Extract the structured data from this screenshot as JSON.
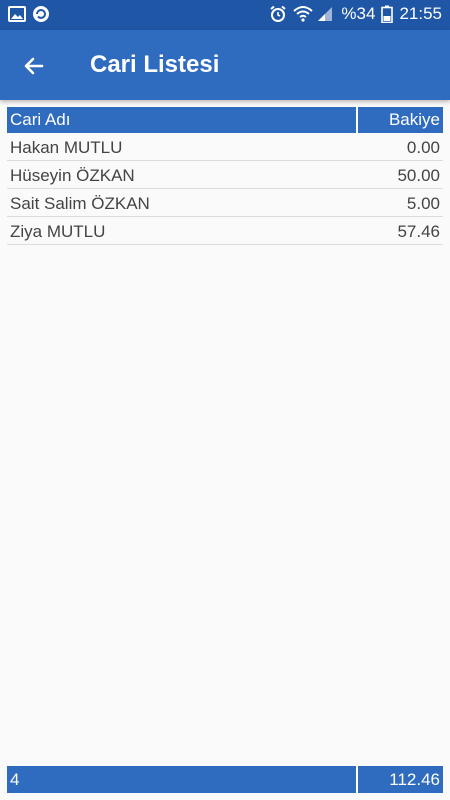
{
  "status_bar": {
    "battery_text": "%34",
    "time": "21:55",
    "icons": [
      "gallery-icon",
      "sync-app-icon",
      "alarm-icon",
      "wifi-icon",
      "signal-icon",
      "battery-icon"
    ]
  },
  "app_bar": {
    "title": "Cari Listesi",
    "back_icon": "arrow-left-icon"
  },
  "table": {
    "headers": {
      "name": "Cari Adı",
      "balance": "Bakiye"
    },
    "rows": [
      {
        "name": "Hakan MUTLU",
        "balance": "0.00"
      },
      {
        "name": "Hüseyin ÖZKAN",
        "balance": "50.00"
      },
      {
        "name": "Sait Salim ÖZKAN",
        "balance": "5.00"
      },
      {
        "name": "Ziya MUTLU",
        "balance": "57.46"
      }
    ]
  },
  "footer": {
    "count": "4",
    "total": "112.46"
  },
  "colors": {
    "status_bar": "#1f56a5",
    "primary": "#2f6bbf",
    "background": "#fafafa"
  }
}
